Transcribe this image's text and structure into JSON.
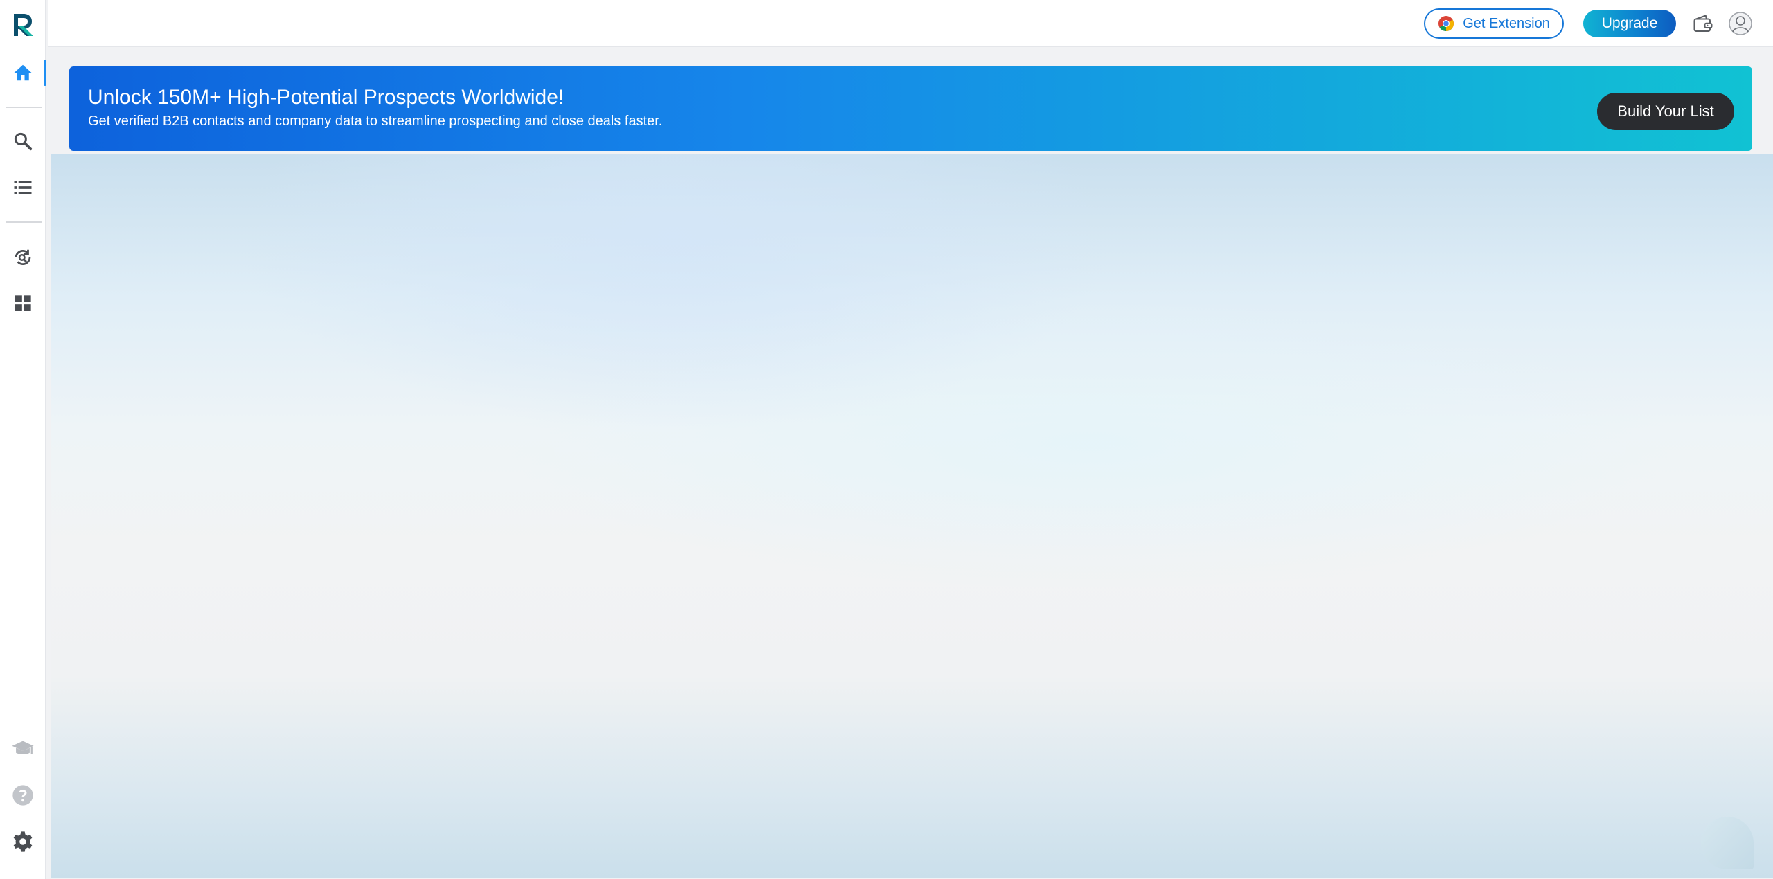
{
  "sidebar": {
    "logo_letter": "R",
    "nav_items": [
      {
        "name": "home",
        "icon": "home-icon",
        "active": true
      },
      {
        "name": "search",
        "icon": "search-icon"
      },
      {
        "name": "lists",
        "icon": "list-icon"
      },
      {
        "name": "enrichment",
        "icon": "sync-search-icon"
      },
      {
        "name": "integrations",
        "icon": "grid-icon"
      }
    ],
    "bottom_items": [
      {
        "name": "academy",
        "icon": "graduation-cap-icon"
      },
      {
        "name": "help",
        "icon": "help-icon"
      },
      {
        "name": "settings",
        "icon": "gear-icon"
      }
    ]
  },
  "topbar": {
    "extension_label": "Get Extension",
    "upgrade_label": "Upgrade"
  },
  "banner": {
    "title": "Unlock 150M+ High-Potential Prospects Worldwide!",
    "subtitle": "Get verified B2B contacts and company data to streamline prospecting and close deals faster.",
    "cta_label": "Build Your List"
  },
  "colors": {
    "accent": "#1677d8",
    "active_nav": "#1f8ff3",
    "cta_dark": "#2a2c30"
  }
}
